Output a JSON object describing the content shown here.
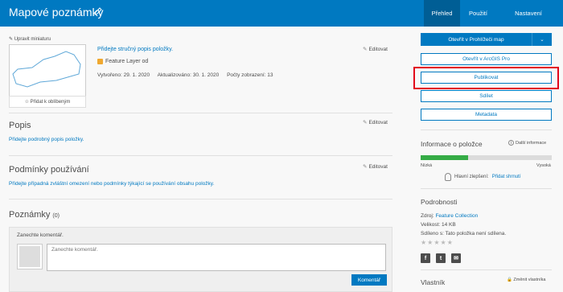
{
  "header": {
    "title": "Mapové poznámky",
    "tabs": [
      {
        "label": "Přehled",
        "active": true
      },
      {
        "label": "Použití",
        "active": false
      },
      {
        "label": "Nastavení",
        "active": false
      }
    ]
  },
  "item": {
    "edit_thumbnail": "Upravit miniaturu",
    "add_favorite": "Přidat k oblíbeným",
    "summary_placeholder": "Přidejte stručný popis položky.",
    "type": "Feature Layer od",
    "created": "Vytvořeno: 29. 1. 2020",
    "updated": "Aktualizováno: 30. 1. 2020",
    "views": "Počty zobrazení: 13",
    "edit_label": "Editovat"
  },
  "description": {
    "title": "Popis",
    "placeholder": "Přidejte podrobný popis položky."
  },
  "terms": {
    "title": "Podmínky používání",
    "placeholder": "Přidejte případná zvláštní omezení nebo podmínky týkající se používání obsahu položky."
  },
  "comments": {
    "title": "Poznámky",
    "count": "(0)",
    "prompt": "Zanechte komentář.",
    "input_placeholder": "Zanechte komentář.",
    "submit": "Komentář"
  },
  "actions": {
    "open_map_viewer": "Otevřít v Prohlížeči map",
    "open_arcgis_pro": "Otevřít v ArcGIS Pro",
    "publish": "Publikovat",
    "share": "Sdílet",
    "metadata": "Metadata"
  },
  "item_info": {
    "title": "Informace o položce",
    "more_info": "Další informace",
    "progress_fraction": 0.36,
    "low_label": "Nízká",
    "high_label": "Vysoká",
    "tip_label": "Hlavní zlepšení:",
    "tip_action": "Přidat shrnutí"
  },
  "details": {
    "title": "Podrobnosti",
    "source_label": "Zdroj:",
    "source_value": "Feature Collection",
    "size": "Velikost: 14 KB",
    "shared_label": "Sdíleno s:",
    "shared_value": "Tato položka není sdílena."
  },
  "owner": {
    "title": "Vlastník",
    "change_owner": "Změnit vlastníka"
  },
  "colors": {
    "brand": "#0079c1",
    "highlight": "#e2001a",
    "progress": "#35ac46"
  }
}
